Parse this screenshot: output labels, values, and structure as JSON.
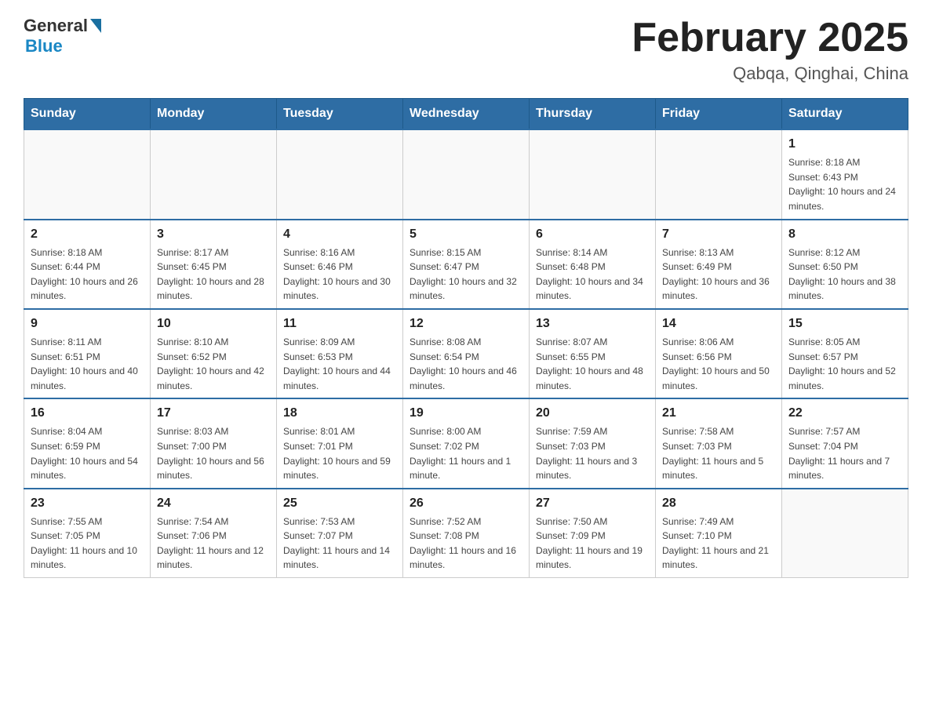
{
  "header": {
    "logo_general": "General",
    "logo_blue": "Blue",
    "title": "February 2025",
    "location": "Qabqa, Qinghai, China"
  },
  "days_of_week": [
    "Sunday",
    "Monday",
    "Tuesday",
    "Wednesday",
    "Thursday",
    "Friday",
    "Saturday"
  ],
  "weeks": [
    [
      {
        "day": "",
        "info": ""
      },
      {
        "day": "",
        "info": ""
      },
      {
        "day": "",
        "info": ""
      },
      {
        "day": "",
        "info": ""
      },
      {
        "day": "",
        "info": ""
      },
      {
        "day": "",
        "info": ""
      },
      {
        "day": "1",
        "info": "Sunrise: 8:18 AM\nSunset: 6:43 PM\nDaylight: 10 hours and 24 minutes."
      }
    ],
    [
      {
        "day": "2",
        "info": "Sunrise: 8:18 AM\nSunset: 6:44 PM\nDaylight: 10 hours and 26 minutes."
      },
      {
        "day": "3",
        "info": "Sunrise: 8:17 AM\nSunset: 6:45 PM\nDaylight: 10 hours and 28 minutes."
      },
      {
        "day": "4",
        "info": "Sunrise: 8:16 AM\nSunset: 6:46 PM\nDaylight: 10 hours and 30 minutes."
      },
      {
        "day": "5",
        "info": "Sunrise: 8:15 AM\nSunset: 6:47 PM\nDaylight: 10 hours and 32 minutes."
      },
      {
        "day": "6",
        "info": "Sunrise: 8:14 AM\nSunset: 6:48 PM\nDaylight: 10 hours and 34 minutes."
      },
      {
        "day": "7",
        "info": "Sunrise: 8:13 AM\nSunset: 6:49 PM\nDaylight: 10 hours and 36 minutes."
      },
      {
        "day": "8",
        "info": "Sunrise: 8:12 AM\nSunset: 6:50 PM\nDaylight: 10 hours and 38 minutes."
      }
    ],
    [
      {
        "day": "9",
        "info": "Sunrise: 8:11 AM\nSunset: 6:51 PM\nDaylight: 10 hours and 40 minutes."
      },
      {
        "day": "10",
        "info": "Sunrise: 8:10 AM\nSunset: 6:52 PM\nDaylight: 10 hours and 42 minutes."
      },
      {
        "day": "11",
        "info": "Sunrise: 8:09 AM\nSunset: 6:53 PM\nDaylight: 10 hours and 44 minutes."
      },
      {
        "day": "12",
        "info": "Sunrise: 8:08 AM\nSunset: 6:54 PM\nDaylight: 10 hours and 46 minutes."
      },
      {
        "day": "13",
        "info": "Sunrise: 8:07 AM\nSunset: 6:55 PM\nDaylight: 10 hours and 48 minutes."
      },
      {
        "day": "14",
        "info": "Sunrise: 8:06 AM\nSunset: 6:56 PM\nDaylight: 10 hours and 50 minutes."
      },
      {
        "day": "15",
        "info": "Sunrise: 8:05 AM\nSunset: 6:57 PM\nDaylight: 10 hours and 52 minutes."
      }
    ],
    [
      {
        "day": "16",
        "info": "Sunrise: 8:04 AM\nSunset: 6:59 PM\nDaylight: 10 hours and 54 minutes."
      },
      {
        "day": "17",
        "info": "Sunrise: 8:03 AM\nSunset: 7:00 PM\nDaylight: 10 hours and 56 minutes."
      },
      {
        "day": "18",
        "info": "Sunrise: 8:01 AM\nSunset: 7:01 PM\nDaylight: 10 hours and 59 minutes."
      },
      {
        "day": "19",
        "info": "Sunrise: 8:00 AM\nSunset: 7:02 PM\nDaylight: 11 hours and 1 minute."
      },
      {
        "day": "20",
        "info": "Sunrise: 7:59 AM\nSunset: 7:03 PM\nDaylight: 11 hours and 3 minutes."
      },
      {
        "day": "21",
        "info": "Sunrise: 7:58 AM\nSunset: 7:03 PM\nDaylight: 11 hours and 5 minutes."
      },
      {
        "day": "22",
        "info": "Sunrise: 7:57 AM\nSunset: 7:04 PM\nDaylight: 11 hours and 7 minutes."
      }
    ],
    [
      {
        "day": "23",
        "info": "Sunrise: 7:55 AM\nSunset: 7:05 PM\nDaylight: 11 hours and 10 minutes."
      },
      {
        "day": "24",
        "info": "Sunrise: 7:54 AM\nSunset: 7:06 PM\nDaylight: 11 hours and 12 minutes."
      },
      {
        "day": "25",
        "info": "Sunrise: 7:53 AM\nSunset: 7:07 PM\nDaylight: 11 hours and 14 minutes."
      },
      {
        "day": "26",
        "info": "Sunrise: 7:52 AM\nSunset: 7:08 PM\nDaylight: 11 hours and 16 minutes."
      },
      {
        "day": "27",
        "info": "Sunrise: 7:50 AM\nSunset: 7:09 PM\nDaylight: 11 hours and 19 minutes."
      },
      {
        "day": "28",
        "info": "Sunrise: 7:49 AM\nSunset: 7:10 PM\nDaylight: 11 hours and 21 minutes."
      },
      {
        "day": "",
        "info": ""
      }
    ]
  ]
}
